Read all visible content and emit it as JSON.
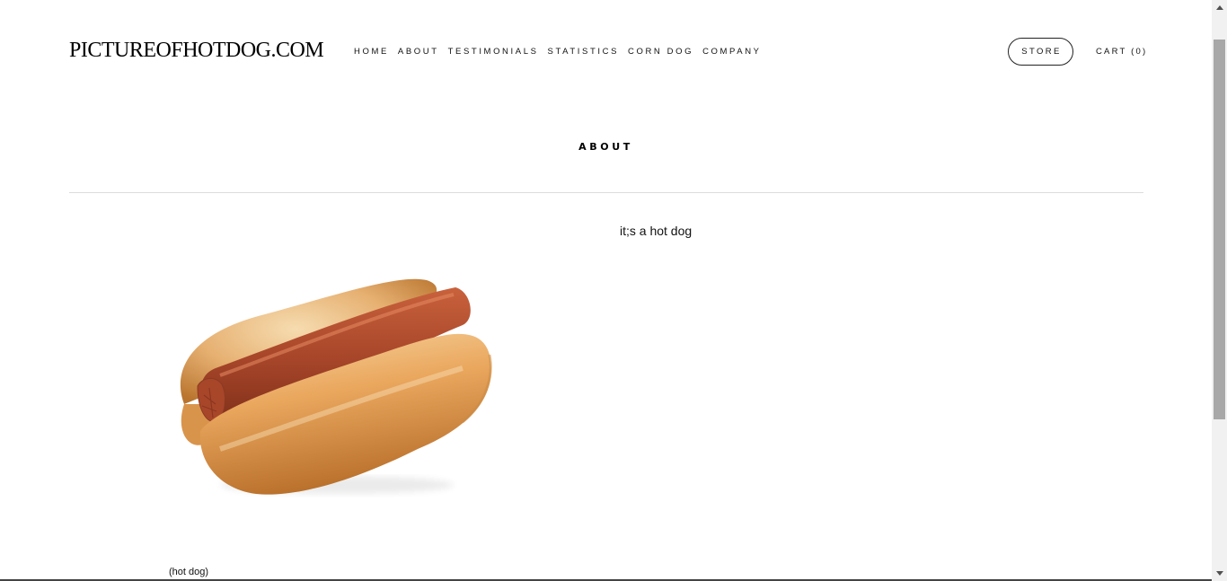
{
  "header": {
    "logo": "PICTUREOFHOTDOG.COM",
    "nav": [
      "HOME",
      "ABOUT",
      "TESTIMONIALS",
      "STATISTICS",
      "CORN DOG",
      "COMPANY"
    ],
    "store_label": "STORE",
    "cart_label": "CART (0)"
  },
  "main": {
    "title": "ABOUT",
    "tagline": "it;s a hot dog",
    "caption": "(hot dog)"
  },
  "icons": {
    "scroll_up": "scroll-up-arrow-icon",
    "scroll_down": "scroll-down-arrow-icon"
  },
  "colors": {
    "text": "#111111",
    "divider": "#dcdcdc",
    "sausage": "#a8462a",
    "bun": "#e5a35c"
  }
}
